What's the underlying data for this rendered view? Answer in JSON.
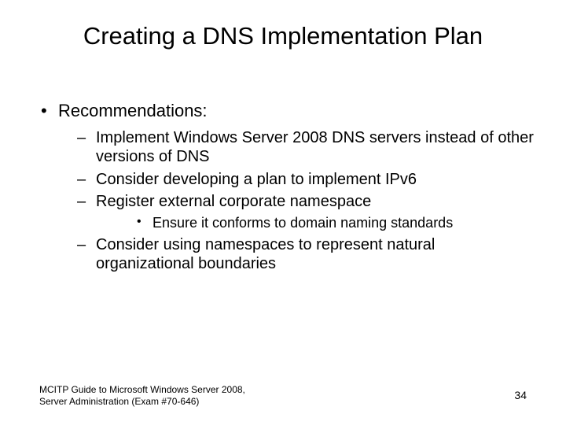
{
  "title": "Creating a DNS Implementation Plan",
  "body": {
    "heading": "Recommendations:",
    "items": [
      {
        "text": "Implement Windows Server 2008 DNS servers instead of other versions of DNS"
      },
      {
        "text": "Consider developing a plan to implement IPv6"
      },
      {
        "text": "Register external corporate namespace",
        "sub": [
          {
            "text": "Ensure it conforms to domain naming standards"
          }
        ]
      },
      {
        "text": "Consider using namespaces to represent natural organizational boundaries"
      }
    ]
  },
  "footer": {
    "left_line1": "MCITP Guide to Microsoft Windows Server 2008,",
    "left_line2": "Server Administration (Exam #70-646)",
    "page_number": "34"
  }
}
